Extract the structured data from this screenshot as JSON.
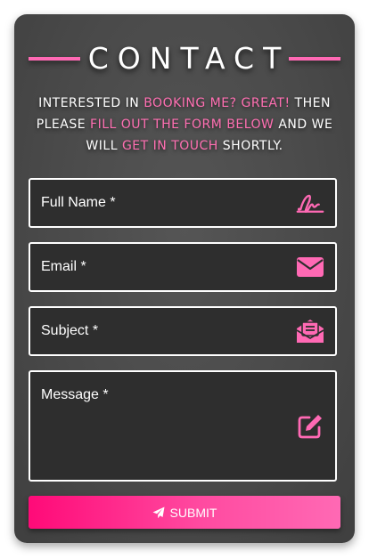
{
  "header": {
    "title": "CONTACT"
  },
  "intro": {
    "part1": "INTERESTED IN ",
    "part2": "BOOKING ME? GREAT!",
    "part3": " THEN PLEASE ",
    "part4": "FILL OUT THE FORM BELOW",
    "part5": " AND WE WILL ",
    "part6": "GET IN TOUCH",
    "part7": " SHORTLY."
  },
  "form": {
    "fields": [
      {
        "label": "Full Name *",
        "icon": "signature-icon"
      },
      {
        "label": "Email *",
        "icon": "envelope-icon"
      },
      {
        "label": "Subject *",
        "icon": "envelope-open-text-icon"
      },
      {
        "label": "Message *",
        "icon": "edit-icon"
      }
    ],
    "submit_label": "SUBMIT",
    "submit_icon": "paper-plane-icon"
  },
  "colors": {
    "accent": "#ff69b4",
    "button_start": "#ff0a78",
    "card": "#4a4a4a",
    "field_bg": "#2e2e2e"
  }
}
